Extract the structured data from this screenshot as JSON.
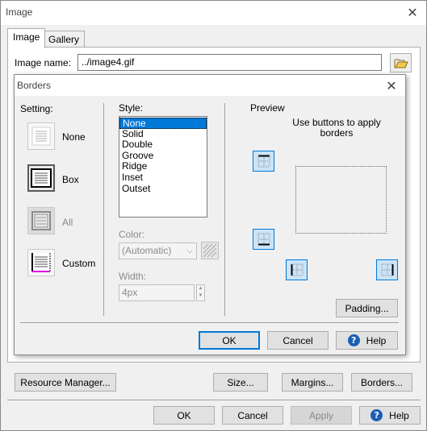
{
  "window": {
    "title": "Image"
  },
  "tabs": [
    {
      "label": "Image"
    },
    {
      "label": "Gallery"
    }
  ],
  "image_name": {
    "label": "Image name:",
    "value": "../image4.gif"
  },
  "borders_dialog": {
    "title": "Borders",
    "setting": {
      "label": "Setting:",
      "options": [
        {
          "label": "None"
        },
        {
          "label": "Box"
        },
        {
          "label": "All"
        },
        {
          "label": "Custom"
        }
      ],
      "selected": "Box"
    },
    "style": {
      "label": "Style:",
      "options": [
        "None",
        "Solid",
        "Double",
        "Groove",
        "Ridge",
        "Inset",
        "Outset"
      ],
      "selected": "None"
    },
    "color": {
      "label": "Color:",
      "value": "(Automatic)"
    },
    "width": {
      "label": "Width:",
      "value": "4px"
    },
    "preview": {
      "label": "Preview",
      "hint": "Use buttons to apply borders"
    },
    "padding_button": "Padding...",
    "ok_button": "OK",
    "cancel_button": "Cancel",
    "help_button": "Help"
  },
  "lower_buttons": {
    "resource_manager": "Resource Manager...",
    "size": "Size...",
    "margins": "Margins...",
    "borders": "Borders..."
  },
  "footer": {
    "ok": "OK",
    "cancel": "Cancel",
    "apply": "Apply",
    "help": "Help"
  },
  "colors": {
    "accent": "#0078d7",
    "help_icon": "#1a5fb4",
    "custom_border": "#e000e0"
  }
}
